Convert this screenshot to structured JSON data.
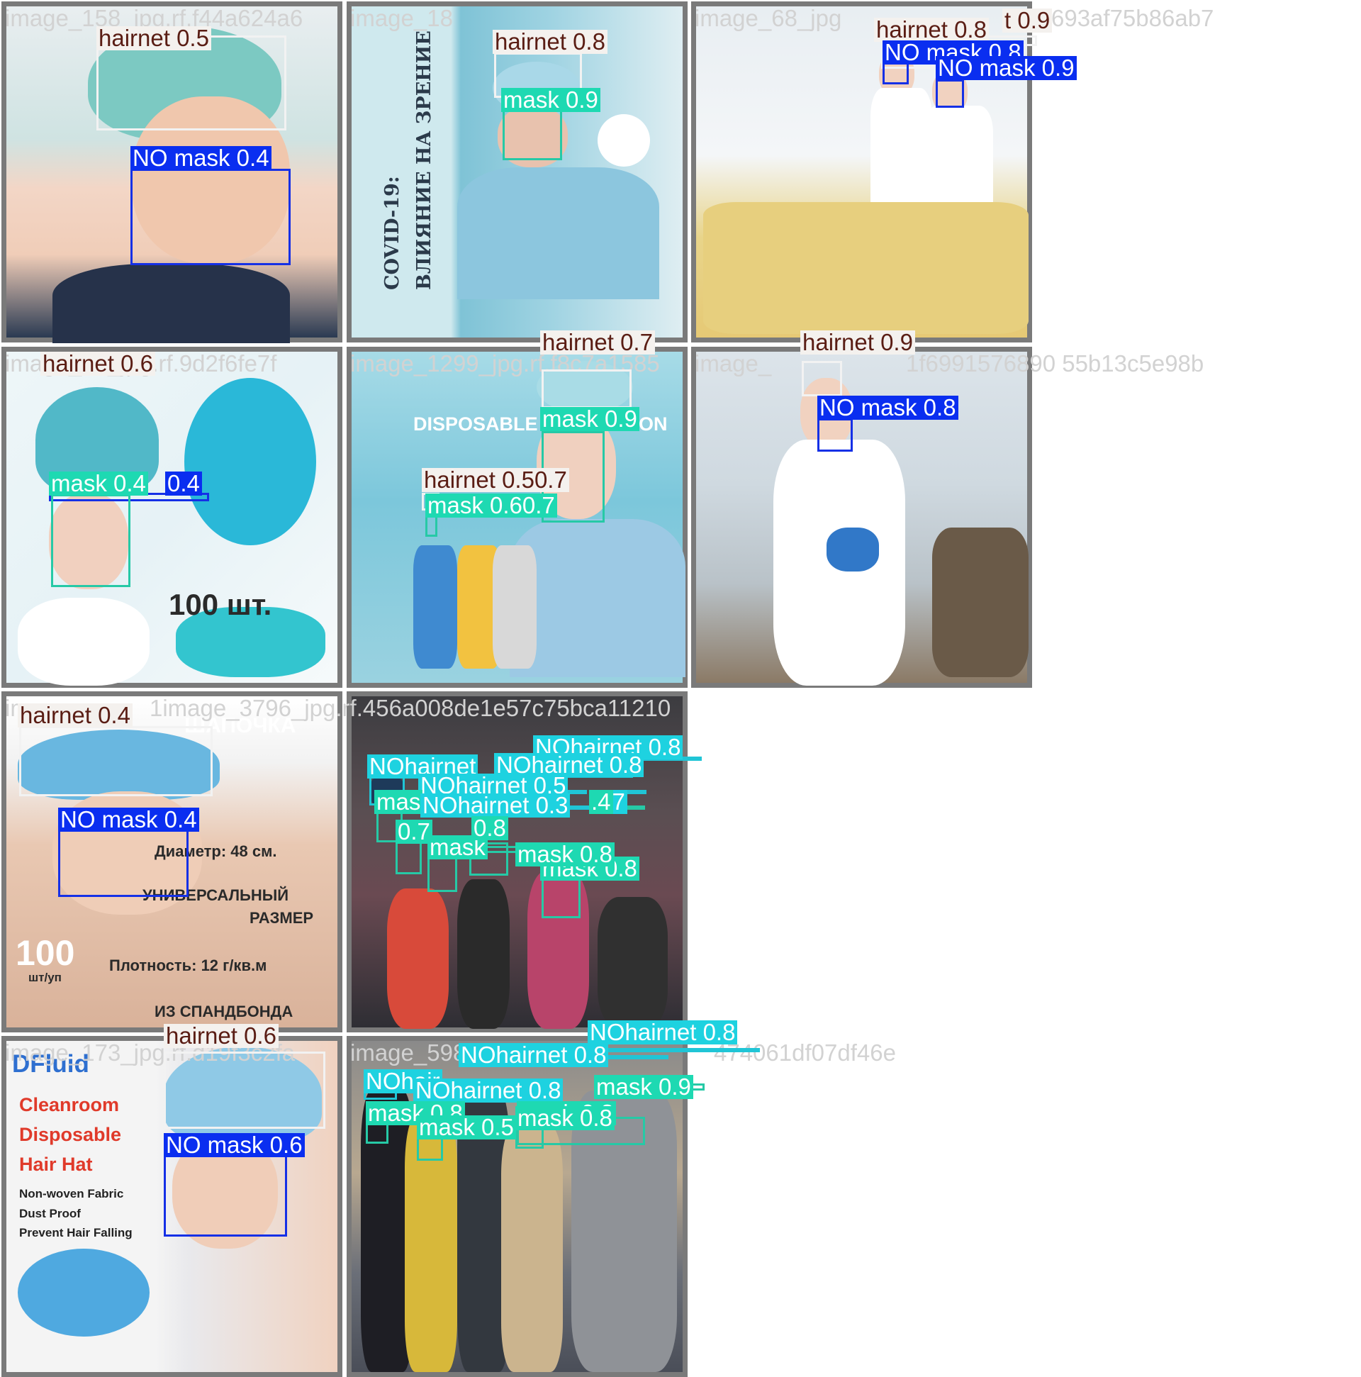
{
  "colors": {
    "hairnet": "#f4f1ee",
    "no_mask": "#0a2ef0",
    "mask": "#1ed9b2",
    "no_hairnet": "#1ed2e0",
    "tile_border": "#7a7a7a",
    "filename_text": "#d2d2d2"
  },
  "tiles": [
    {
      "filename": "image_158_jpg.rf.f44a624a6",
      "detections": [
        {
          "cls": "hairnet",
          "label": "hairnet 0.5"
        },
        {
          "cls": "nomask",
          "label": "NO mask 0.4"
        }
      ]
    },
    {
      "filename": "image_18",
      "photo_text": [
        "COVID-19:",
        "ВЛИЯНИЕ НА ЗРЕНИЕ"
      ],
      "detections": [
        {
          "cls": "hairnet",
          "label": "hairnet 0.8"
        },
        {
          "cls": "mask",
          "label": "mask 0.9"
        }
      ]
    },
    {
      "filename": "image_68_jpg",
      "filename_tail": "693af75b86ab7",
      "detections": [
        {
          "cls": "hairnet",
          "label": "hairnet 0.8"
        },
        {
          "cls": "hairnet",
          "label": "t 0.9"
        },
        {
          "cls": "nomask",
          "label": "NO mask 0.8"
        },
        {
          "cls": "nomask",
          "label": "NO mask 0.9"
        }
      ]
    },
    {
      "filename": "image_14_jpg.rf.9d2f6fe7f",
      "photo_text": [
        "100 шт."
      ],
      "detections": [
        {
          "cls": "hairnet",
          "label": "hairnet 0.6"
        },
        {
          "cls": "nomask",
          "label": "0.4"
        },
        {
          "cls": "mask",
          "label": "mask 0.4"
        }
      ]
    },
    {
      "filename": "image_1299_jpg.rf.f8c7a1585",
      "photo_text": [
        "DISPOSABLE COLLECTION"
      ],
      "detections": [
        {
          "cls": "hairnet",
          "label": "hairnet 0.7"
        },
        {
          "cls": "mask",
          "label": "mask 0.9"
        },
        {
          "cls": "hairnet",
          "label": "hairnet 0.50.7"
        },
        {
          "cls": "mask",
          "label": "mask 0.60.7"
        }
      ]
    },
    {
      "filename": "image_",
      "filename_tail": "1f6991576890 55b13c5e98b",
      "detections": [
        {
          "cls": "hairnet",
          "label": "hairnet 0.9"
        },
        {
          "cls": "nomask",
          "label": "NO mask 0.8"
        }
      ]
    },
    {
      "filename": "image_",
      "filename_tail": "1image_3796_jpg.rf.456a008de1e57c75bca11210",
      "photo_text": [
        "ШАПОЧКА",
        "Диаметр: 48 см.",
        "УНИВЕРСАЛЬНЫЙ",
        "РАЗМЕР",
        "100",
        "шт/уп",
        "Плотность: 12 г/кв.м",
        "ИЗ СПАНДБОНДА"
      ],
      "detections": [
        {
          "cls": "hairnet",
          "label": "hairnet 0.4"
        },
        {
          "cls": "nomask",
          "label": "NO mask 0.4"
        }
      ]
    },
    {
      "filename": "",
      "detections": [
        {
          "cls": "nohairnet",
          "label": "NOhairnet 0.8"
        },
        {
          "cls": "nohairnet",
          "label": "NOhairnet"
        },
        {
          "cls": "nohairnet",
          "label": "NOhairnet 0.8"
        },
        {
          "cls": "nohairnet",
          "label": "NOhairnet 0.5"
        },
        {
          "cls": "nohairnet",
          "label": "0.7"
        },
        {
          "cls": "mask",
          "label": "mas"
        },
        {
          "cls": "nohairnet",
          "label": "NOhairnet 0.3"
        },
        {
          "cls": "mask",
          "label": ".4"
        },
        {
          "cls": "mask",
          "label": "0.7"
        },
        {
          "cls": "mask",
          "label": "mask"
        },
        {
          "cls": "mask",
          "label": "0.8"
        },
        {
          "cls": "mask",
          "label": "mask 0.8"
        },
        {
          "cls": "mask",
          "label": "mask 0.8"
        }
      ]
    },
    {
      "filename": "image_173_jpg.rf.d19f3c2fa",
      "photo_text": [
        "DFluid",
        "Cleanroom",
        "Disposable",
        "Hair Hat",
        "Non-woven Fabric",
        "Dust Proof",
        "Prevent Hair Falling"
      ],
      "detections": [
        {
          "cls": "hairnet",
          "label": "hairnet 0.6"
        },
        {
          "cls": "nomask",
          "label": "NO mask 0.6"
        }
      ]
    },
    {
      "filename": "image_598",
      "filename_tail": "474061df07df46e",
      "detections": [
        {
          "cls": "nohairnet",
          "label": "NOhairnet 0.8"
        },
        {
          "cls": "nohairnet",
          "label": "NOhairnet 0.8"
        },
        {
          "cls": "nohairnet",
          "label": "NOhair"
        },
        {
          "cls": "nohairnet",
          "label": "NOhairnet 0.8"
        },
        {
          "cls": "mask",
          "label": "mask 0.8"
        },
        {
          "cls": "mask",
          "label": "mask 0.9"
        },
        {
          "cls": "mask",
          "label": "mask 0.8"
        },
        {
          "cls": "mask",
          "label": "mask 0.5"
        },
        {
          "cls": "mask",
          "label": "mask 0.8"
        }
      ]
    }
  ]
}
